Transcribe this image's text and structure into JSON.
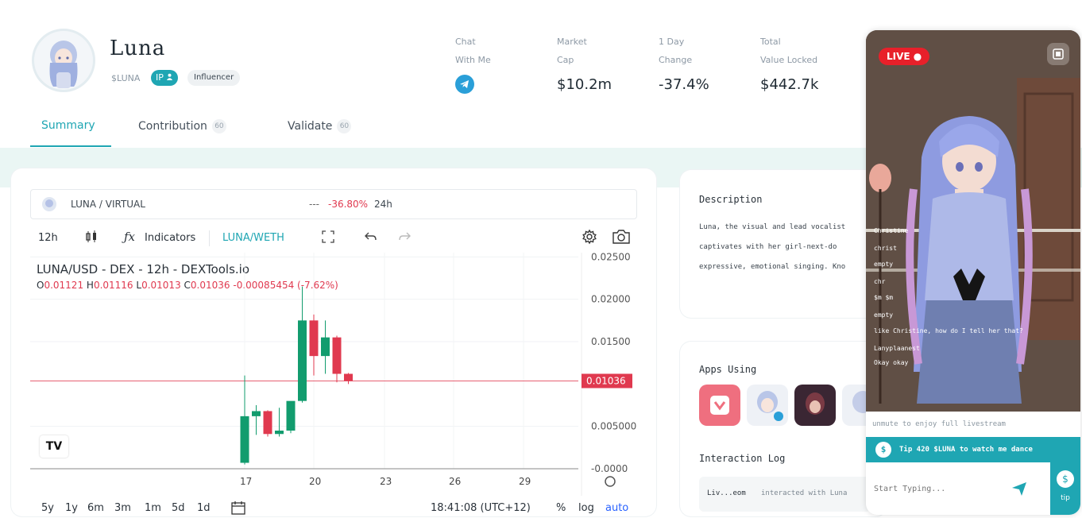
{
  "header": {
    "title": "Luna",
    "ticker": "$LUNA",
    "ip_badge": "IP",
    "role_badge": "Influencer"
  },
  "stats": [
    {
      "label1": "Chat",
      "label2": "With Me",
      "value": ""
    },
    {
      "label1": "Market",
      "label2": "Cap",
      "value": "$10.2m"
    },
    {
      "label1": "1 Day",
      "label2": "Change",
      "value": "-37.4%"
    },
    {
      "label1": "Total",
      "label2": "Value Locked",
      "value": "$442.7k"
    }
  ],
  "tabs": [
    {
      "label": "Summary",
      "badge": ""
    },
    {
      "label": "Contribution",
      "badge": "60"
    },
    {
      "label": "Validate",
      "badge": "60"
    }
  ],
  "pair": {
    "name": "LUNA / VIRTUAL",
    "dashes": "---",
    "change": "-36.80%",
    "period": "24h"
  },
  "toolbar": {
    "interval": "12h",
    "indicators": "Indicators",
    "pair_toggle": "LUNA/WETH"
  },
  "chart_info": {
    "title": "LUNA/USD - DEX - 12h - DEXTools.io",
    "o": "0.01121",
    "h": "0.01116",
    "l": "0.01013",
    "c": "0.01036",
    "delta": "-0.00085454 (-7.62%)",
    "o_label": "O",
    "h_label": "H",
    "l_label": "L",
    "c_label": "C"
  },
  "chart_data": {
    "type": "candlestick",
    "y_ticks": [
      "0.02500",
      "0.02000",
      "0.01500",
      "0.01036",
      "0.005000",
      "-0.0000"
    ],
    "x_ticks": [
      "17",
      "20",
      "23",
      "26",
      "29"
    ],
    "last_price": 0.01036,
    "ylim": [
      0,
      0.0255
    ],
    "candles": [
      {
        "o": 0.0007,
        "h": 0.011,
        "l": 0.0005,
        "c": 0.0062
      },
      {
        "o": 0.0062,
        "h": 0.0075,
        "l": 0.004,
        "c": 0.0068
      },
      {
        "o": 0.0068,
        "h": 0.0069,
        "l": 0.0038,
        "c": 0.0041
      },
      {
        "o": 0.0041,
        "h": 0.0072,
        "l": 0.0038,
        "c": 0.0045
      },
      {
        "o": 0.0045,
        "h": 0.0078,
        "l": 0.0042,
        "c": 0.008
      },
      {
        "o": 0.008,
        "h": 0.0215,
        "l": 0.0078,
        "c": 0.0175
      },
      {
        "o": 0.0175,
        "h": 0.0182,
        "l": 0.011,
        "c": 0.0133
      },
      {
        "o": 0.0133,
        "h": 0.0175,
        "l": 0.0112,
        "c": 0.0155
      },
      {
        "o": 0.0155,
        "h": 0.0157,
        "l": 0.0102,
        "c": 0.0112
      },
      {
        "o": 0.0112,
        "h": 0.0113,
        "l": 0.01,
        "c": 0.01036
      }
    ]
  },
  "bottom_bar": {
    "ranges": [
      "5y",
      "1y",
      "6m",
      "3m",
      "1m",
      "5d",
      "1d"
    ],
    "time": "18:41:08 (UTC+12)",
    "percent": "%",
    "log": "log",
    "auto": "auto"
  },
  "description": {
    "title": "Description",
    "lines": [
      "Luna, the visual and lead vocalist",
      "captivates with her girl-next-do",
      "expressive, emotional singing. Kno"
    ]
  },
  "apps": {
    "title": "Apps Using"
  },
  "interaction_log": {
    "title": "Interaction Log",
    "row_user": "Liv...eom",
    "row_text": "interacted with Luna"
  },
  "live": {
    "badge": "LIVE",
    "chat": [
      "Christine",
      "christ",
      "empty",
      "chr",
      "$m $m",
      "empty",
      "like Christine, how do I tell her that?",
      "Lanyplaanest",
      "Okay okay"
    ],
    "unmute": "unmute to enjoy full livestream",
    "tip_bar": "Tip 420 $LUNA to watch me dance",
    "input_placeholder": "Start Typing...",
    "tip_button": "tip"
  },
  "colors": {
    "accent": "#1fa6b3",
    "up": "#129c6e",
    "down": "#e0394f",
    "live": "#e8202a"
  }
}
